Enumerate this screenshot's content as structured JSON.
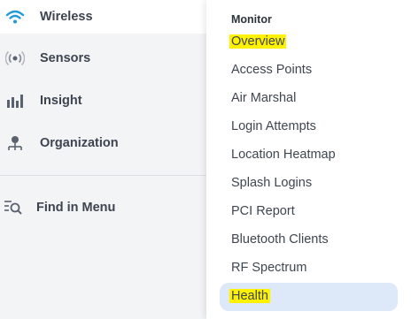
{
  "sidebar": {
    "items": [
      {
        "label": "Wireless",
        "icon": "wifi-icon",
        "active": true
      },
      {
        "label": "Sensors",
        "icon": "sensor-signal-icon"
      },
      {
        "label": "Insight",
        "icon": "bar-chart-icon"
      },
      {
        "label": "Organization",
        "icon": "organization-icon"
      }
    ],
    "find_in_menu": {
      "label": "Find in Menu",
      "icon": "search-list-icon"
    }
  },
  "flyout": {
    "section_title": "Monitor",
    "items": [
      {
        "label": "Overview"
      },
      {
        "label": "Access Points"
      },
      {
        "label": "Air Marshal"
      },
      {
        "label": "Login Attempts"
      },
      {
        "label": "Location Heatmap"
      },
      {
        "label": "Splash Logins"
      },
      {
        "label": "PCI Report"
      },
      {
        "label": "Bluetooth Clients"
      },
      {
        "label": "RF Spectrum"
      },
      {
        "label": "Health",
        "selected": true
      }
    ]
  },
  "colors": {
    "accent": "#1f9ad6",
    "highlight": "#fff200",
    "selected_bg": "#dde8f9",
    "sidebar_bg": "#f3f4f6"
  }
}
